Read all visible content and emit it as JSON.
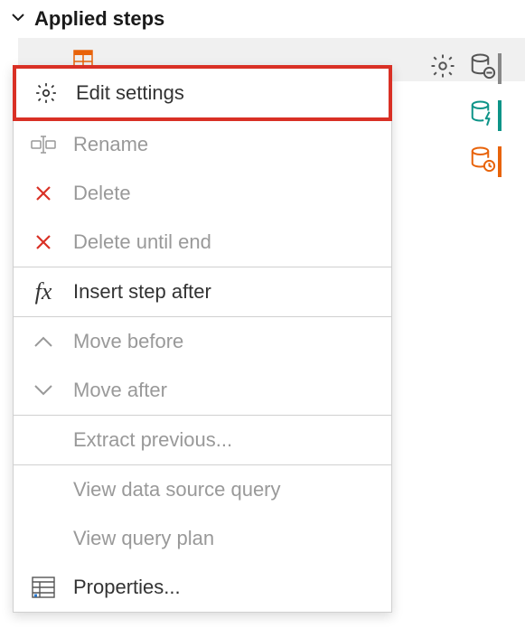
{
  "panel": {
    "title": "Applied steps"
  },
  "context_menu": {
    "items": [
      {
        "label": "Edit settings",
        "enabled": true,
        "highlighted": true,
        "icon": "gear"
      },
      {
        "label": "Rename",
        "enabled": false,
        "icon": "rename"
      },
      {
        "label": "Delete",
        "enabled": false,
        "icon": "delete"
      },
      {
        "label": "Delete until end",
        "enabled": false,
        "icon": "delete"
      },
      {
        "divider": true
      },
      {
        "label": "Insert step after",
        "enabled": true,
        "icon": "fx"
      },
      {
        "divider": true
      },
      {
        "label": "Move before",
        "enabled": false,
        "icon": "chevron-up"
      },
      {
        "label": "Move after",
        "enabled": false,
        "icon": "chevron-down"
      },
      {
        "divider": true
      },
      {
        "label": "Extract previous...",
        "enabled": false,
        "icon": ""
      },
      {
        "divider": true
      },
      {
        "label": "View data source query",
        "enabled": false,
        "icon": ""
      },
      {
        "label": "View query plan",
        "enabled": false,
        "icon": ""
      },
      {
        "label": "Properties...",
        "enabled": true,
        "icon": "properties"
      }
    ]
  }
}
